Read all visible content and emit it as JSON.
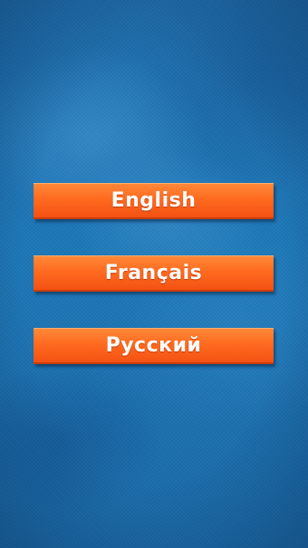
{
  "language_menu": {
    "options": [
      {
        "label": "English"
      },
      {
        "label": "Français"
      },
      {
        "label": "Русский"
      }
    ]
  },
  "colors": {
    "background": "#1d74b4",
    "button": "#ff6a1f",
    "button_text": "#ffffff"
  }
}
